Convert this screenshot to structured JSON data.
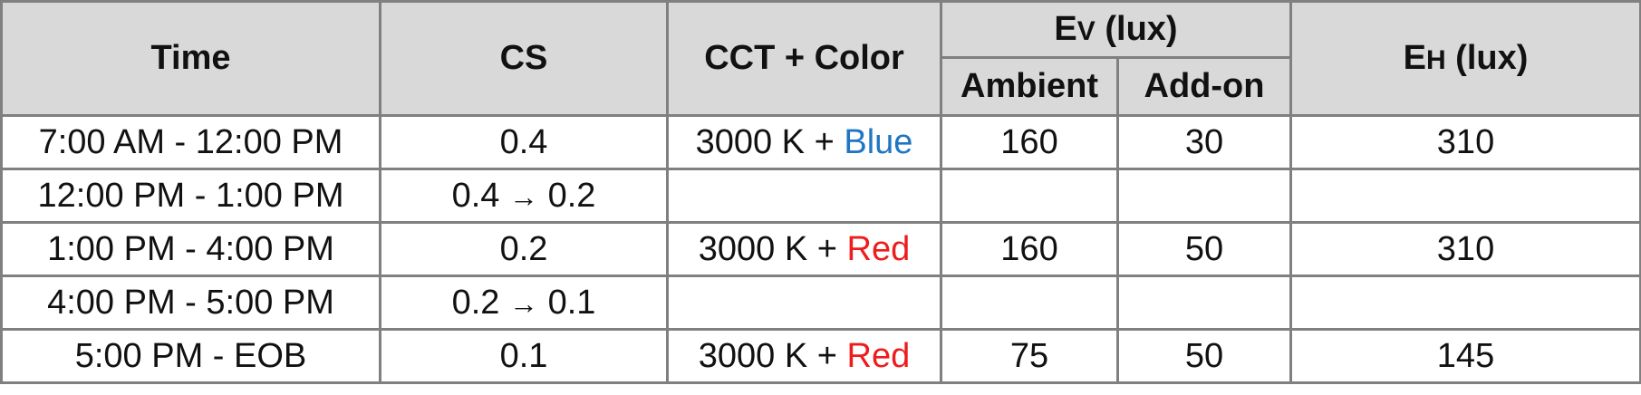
{
  "header": {
    "time": "Time",
    "cs": "CS",
    "cct_color": "CCT + Color",
    "ev_letter": "E",
    "ev_sub": "V",
    "ev_unit": " (lux)",
    "eh_letter": "E",
    "eh_sub": "H",
    "eh_unit": " (lux)",
    "ambient": "Ambient",
    "addon": "Add-on"
  },
  "colors": {
    "blue": "#1f77c4",
    "red": "#ee1c1c",
    "cct_cell_bg": "#fff2cc",
    "empty_cell_bg": "#d0cece",
    "header_bg": "#d9d9d9",
    "border": "#808080"
  },
  "rows": [
    {
      "time": "7:00 AM - 12:00 PM",
      "cs_from": "0.4",
      "cs_arrow": "",
      "cs_to": "",
      "cct": "3000 K + ",
      "color": "Blue",
      "ambient": "160",
      "addon": "30",
      "eh": "310"
    },
    {
      "time": "12:00 PM - 1:00 PM",
      "cs_from": "0.4",
      "cs_arrow": "→",
      "cs_to": "0.2",
      "cct": "",
      "color": "",
      "ambient": "",
      "addon": "",
      "eh": ""
    },
    {
      "time": "1:00 PM - 4:00 PM",
      "cs_from": "0.2",
      "cs_arrow": "",
      "cs_to": "",
      "cct": "3000 K + ",
      "color": "Red",
      "ambient": "160",
      "addon": "50",
      "eh": "310"
    },
    {
      "time": "4:00 PM - 5:00 PM",
      "cs_from": "0.2",
      "cs_arrow": "→",
      "cs_to": "0.1",
      "cct": "",
      "color": "",
      "ambient": "",
      "addon": "",
      "eh": ""
    },
    {
      "time": "5:00 PM - EOB",
      "cs_from": "0.1",
      "cs_arrow": "",
      "cs_to": "",
      "cct": "3000 K + ",
      "color": "Red",
      "ambient": "75",
      "addon": "50",
      "eh": "145"
    }
  ]
}
